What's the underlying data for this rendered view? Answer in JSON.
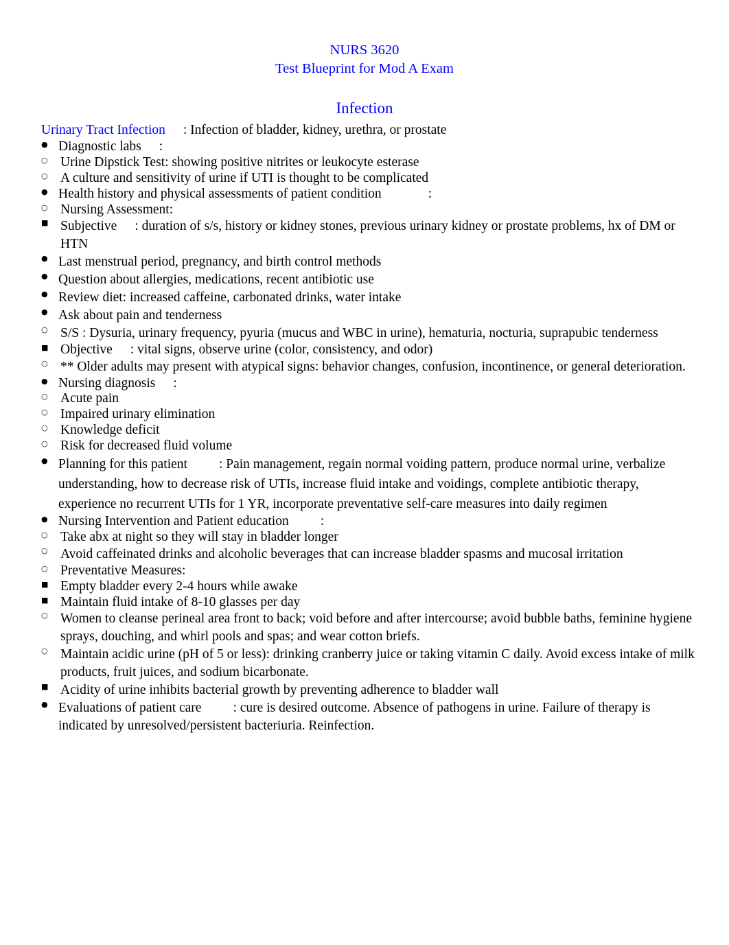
{
  "document": {
    "header": {
      "course": "NURS 3620",
      "subtitle": "Test Blueprint for Mod A Exam"
    },
    "section_heading": "Infection",
    "topic": {
      "label": "Urinary Tract Infection",
      "definition": ": Infection of bladder, kidney, urethra, or prostate"
    },
    "outline": {
      "diagnostic_labs": {
        "label": "Diagnostic labs",
        "colon": ":",
        "items": [
          "Urine Dipstick Test: showing positive nitrites or leukocyte esterase",
          "A culture and sensitivity of urine if UTI is thought to be complicated"
        ]
      },
      "health_history": {
        "label": "Health history and physical assessments of patient condition",
        "colon": ":",
        "nursing_assessment_label": "Nursing Assessment:",
        "subjective": {
          "label": "Subjective",
          "text": ": duration of s/s, history or kidney stones, previous urinary kidney or prostate problems, hx of DM or HTN",
          "points": [
            "Last menstrual period, pregnancy, and birth control methods",
            "Question about allergies, medications, recent antibiotic use",
            "Review diet: increased caffeine, carbonated drinks, water intake",
            "Ask about pain and tenderness"
          ],
          "ss": "S/S : Dysuria, urinary frequency, pyuria (mucus and WBC in urine), hematuria, nocturia, suprapubic tenderness"
        },
        "objective": {
          "label": "Objective",
          "text": ": vital signs, observe urine (color, consistency, and odor)"
        },
        "older_adults_note": "** Older adults may present with atypical signs: behavior changes, confusion, incontinence, or general deterioration."
      },
      "nursing_diagnosis": {
        "label": "Nursing diagnosis",
        "colon": ":",
        "items": [
          "Acute pain",
          "Impaired urinary elimination",
          "Knowledge deficit",
          "Risk for decreased fluid volume"
        ]
      },
      "planning": {
        "label": "Planning for this patient",
        "text": ": Pain management, regain normal voiding pattern, produce normal urine, verbalize understanding, how to decrease risk of UTIs, increase fluid intake and voidings, complete antibiotic therapy, experience no recurrent UTIs for 1 YR, incorporate preventative self-care measures into daily regimen"
      },
      "nursing_intervention": {
        "label": "Nursing Intervention and Patient education",
        "colon": ":",
        "items": [
          "Take abx at night so they will stay in bladder longer",
          "Avoid caffeinated drinks and alcoholic beverages that can increase bladder spasms and mucosal irritation"
        ],
        "preventative": {
          "label": "Preventative Measures:",
          "measures": [
            "Empty bladder every 2-4 hours while awake",
            "Maintain fluid intake of 8-10 glasses per day"
          ]
        },
        "women_hygiene": "Women to cleanse perineal area front to back; void before and after intercourse; avoid bubble baths, feminine hygiene sprays, douching, and whirl pools and spas; and wear cotton briefs.",
        "acidic_urine": "Maintain acidic urine (pH of 5 or less): drinking cranberry juice or taking vitamin C daily. Avoid excess intake of milk products, fruit juices, and sodium bicarbonate.",
        "acidity_note": "Acidity of urine inhibits bacterial growth by preventing adherence to bladder wall"
      },
      "evaluations": {
        "label": "Evaluations of patient care",
        "text": ": cure is desired outcome. Absence of pathogens in urine. Failure of therapy is indicated by unresolved/persistent bacteriuria. Reinfection."
      }
    },
    "colors": {
      "heading_blue": "#0000FF",
      "body_black": "#000000",
      "page_background": "#FFFFFF"
    }
  }
}
